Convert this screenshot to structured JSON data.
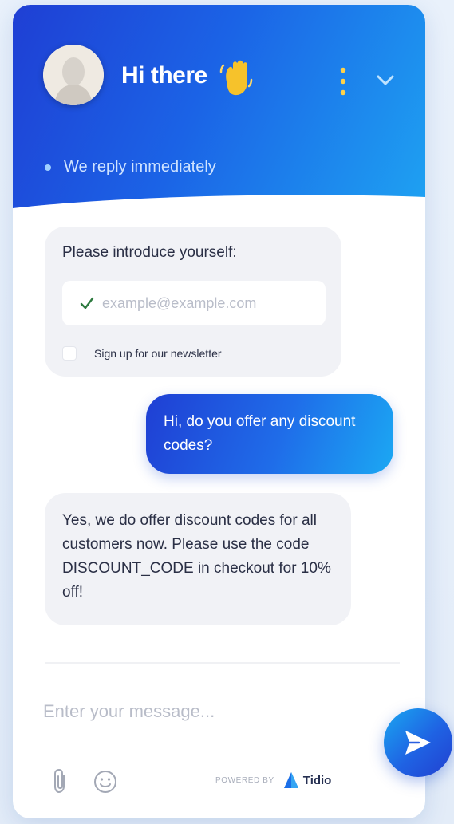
{
  "header": {
    "greeting": "Hi there",
    "status": "We reply immediately",
    "avatar": "agent-avatar",
    "wave_icon": "waving-hand-icon",
    "menu_icon": "kebab-menu-icon",
    "collapse_icon": "chevron-down-icon"
  },
  "messages": {
    "intro": {
      "title": "Please introduce yourself:",
      "email_placeholder": "example@example.com",
      "newsletter_label": "Sign up for our newsletter"
    },
    "user_message": "Hi, do you offer any discount codes?",
    "bot_reply": "Yes, we do offer discount codes for all customers now. Please use the code DISCOUNT_CODE in checkout for 10% off!"
  },
  "composer": {
    "placeholder": "Enter your message...",
    "attach_icon": "paperclip-icon",
    "emoji_icon": "emoji-icon",
    "send_icon": "send-icon"
  },
  "footer": {
    "powered_by": "POWERED BY",
    "brand": "Tidio"
  },
  "colors": {
    "accent_dark": "#1f3fd4",
    "accent_light": "#1ea2f2",
    "bubble_gray": "#f1f2f6",
    "text_dark": "#2a2f45"
  }
}
